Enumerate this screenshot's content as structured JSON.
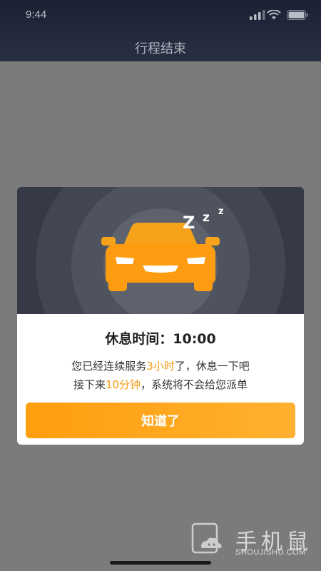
{
  "status_bar": {
    "time": "9:44"
  },
  "nav": {
    "title": "行程结束"
  },
  "dialog": {
    "title": "休息时间：10:00",
    "line1": {
      "pre": "您已经连续服务",
      "highlight": "3小时",
      "post": "了，休息一下吧"
    },
    "line2": {
      "pre": "接下来",
      "highlight": "10分钟",
      "post": "，系统将不会给您派单"
    },
    "confirm_label": "知道了",
    "sleep_text": "Z z z"
  },
  "watermark": {
    "name": "手机鼠",
    "url": "SHOUJISHU.COM"
  },
  "colors": {
    "accent": "#ff9e0d",
    "highlight": "#f39c12",
    "banner_bg": "#2d313c",
    "dim": "#7b7b7b"
  },
  "icons": [
    "signal-icon",
    "wifi-icon",
    "battery-icon",
    "sleeping-car-icon",
    "watermark-logo-icon"
  ]
}
